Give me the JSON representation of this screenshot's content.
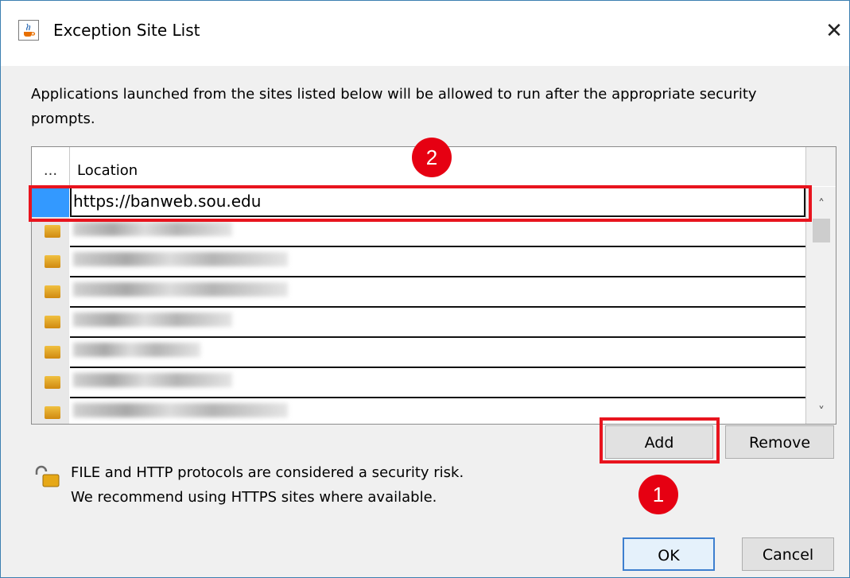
{
  "window": {
    "title": "Exception Site List",
    "close_glyph": "✕"
  },
  "description": "Applications launched from the sites listed below will be allowed to run after the appropriate security prompts.",
  "table": {
    "col_ellipsis": "...",
    "col_location": "Location",
    "selected_row": "https://banweb.sou.edu",
    "scroll_up": "˄",
    "scroll_down": "˅"
  },
  "buttons": {
    "add": "Add",
    "remove": "Remove",
    "ok": "OK",
    "cancel": "Cancel"
  },
  "warning": {
    "line1": "FILE and HTTP protocols are considered a security risk.",
    "line2": "We recommend using HTTPS sites where available."
  },
  "annotations": {
    "step1": "1",
    "step2": "2",
    "highlight_color": "#e8141e"
  },
  "icons": {
    "title": "java-coffee-icon",
    "warning": "unlocked-padlock-icon"
  }
}
